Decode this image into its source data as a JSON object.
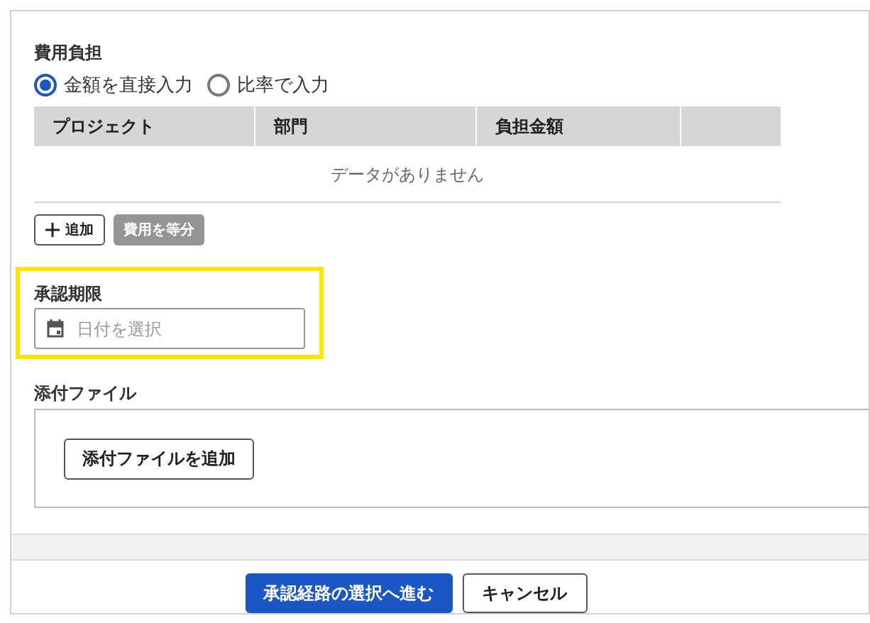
{
  "cost_sharing": {
    "label": "費用負担",
    "options": [
      {
        "label": "金額を直接入力",
        "selected": true
      },
      {
        "label": "比率で入力",
        "selected": false
      }
    ],
    "table": {
      "columns": [
        "プロジェクト",
        "部門",
        "負担金額",
        ""
      ],
      "empty_message": "データがありません"
    },
    "buttons": [
      {
        "label": "追加",
        "kind": "add",
        "disabled": false
      },
      {
        "label": "費用を等分",
        "kind": "split",
        "disabled": true
      }
    ]
  },
  "approval_deadline": {
    "label": "承認期限",
    "placeholder": "日付を選択",
    "highlighted": true
  },
  "attachments": {
    "label": "添付ファイル",
    "button": "添付ファイルを追加"
  },
  "footer": {
    "buttons": [
      {
        "label": "承認経路の選択へ進む",
        "kind": "primary"
      },
      {
        "label": "キャンセル",
        "kind": "secondary"
      }
    ]
  }
}
